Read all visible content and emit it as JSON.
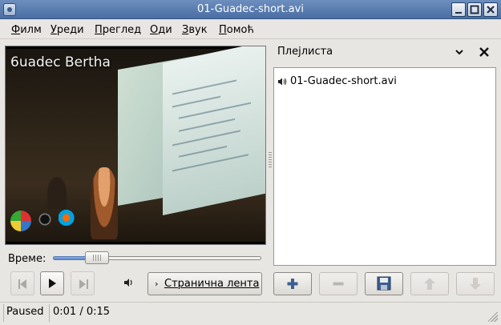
{
  "window": {
    "title": "01-Guadec-short.avi"
  },
  "menu": [
    {
      "label": "Филм",
      "u": "Ф",
      "rest": "илм"
    },
    {
      "label": "Уреди",
      "u": "У",
      "rest": "реди"
    },
    {
      "label": "Преглед",
      "u": "П",
      "rest": "реглед"
    },
    {
      "label": "Оди",
      "u": "О",
      "rest": "ди"
    },
    {
      "label": "Звук",
      "u": "З",
      "rest": "вук"
    },
    {
      "label": "Помоћ",
      "u": "П",
      "rest": "омоћ"
    }
  ],
  "video": {
    "overlay_text": "6uadec Bertha"
  },
  "seek": {
    "label": "Време:",
    "position_fraction": 0.21
  },
  "controls": {
    "previous_icon": "skip-previous-icon",
    "play_icon": "play-icon",
    "next_icon": "skip-next-icon",
    "volume_icon": "volume-icon",
    "sidebar_toggle_label": "Странична лента",
    "sidebar_toggle_arrow": "›"
  },
  "playlist": {
    "header": "Плејлиста",
    "dropdown_glyph": "⌄",
    "close_glyph": "✕",
    "items": [
      {
        "label": "01-Guadec-short.avi",
        "icon": "speaker-icon"
      }
    ],
    "buttons": [
      {
        "name": "add",
        "icon": "plus-icon",
        "enabled": true
      },
      {
        "name": "remove",
        "icon": "minus-icon",
        "enabled": false
      },
      {
        "name": "save",
        "icon": "floppy-icon",
        "enabled": true
      },
      {
        "name": "up",
        "icon": "arrow-up-icon",
        "enabled": false
      },
      {
        "name": "down",
        "icon": "arrow-down-icon",
        "enabled": false
      }
    ]
  },
  "status": {
    "state": "Paused",
    "time": "0:01 / 0:15"
  }
}
